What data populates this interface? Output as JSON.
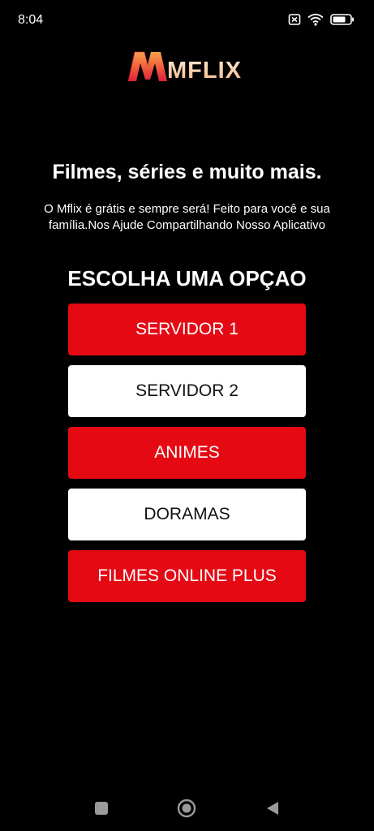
{
  "status_bar": {
    "time": "8:04"
  },
  "logo": {
    "text": "MFLIX"
  },
  "hero": {
    "headline": "Filmes, séries e muito mais.",
    "description": "O Mflix é grátis e sempre será! Feito para você e sua família.Nos Ajude Compartilhando Nosso Aplicativo"
  },
  "menu": {
    "title": "ESCOLHA UMA OPÇAO",
    "options": [
      {
        "label": "SERVIDOR 1",
        "style": "red"
      },
      {
        "label": "SERVIDOR 2",
        "style": "white"
      },
      {
        "label": "ANIMES",
        "style": "red"
      },
      {
        "label": "DORAMAS",
        "style": "white"
      },
      {
        "label": "FILMES ONLINE PLUS",
        "style": "red"
      }
    ]
  },
  "colors": {
    "background": "#000000",
    "accent_red": "#e50914",
    "button_white": "#ffffff"
  },
  "icons": {
    "status": [
      "no-sim-icon",
      "wifi-icon",
      "battery-icon"
    ],
    "navigation": [
      "recent-apps-icon",
      "home-icon",
      "back-icon"
    ]
  }
}
